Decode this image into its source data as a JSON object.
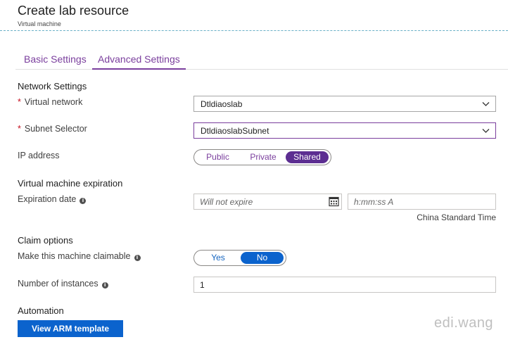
{
  "header": {
    "title": "Create lab resource",
    "subtitle": "Virtual machine"
  },
  "tabs": [
    {
      "label": "Basic Settings",
      "active": false
    },
    {
      "label": "Advanced Settings",
      "active": true
    }
  ],
  "network": {
    "section": "Network Settings",
    "virtual_network": {
      "label": "Virtual network",
      "value": "Dtldiaoslab"
    },
    "subnet": {
      "label": "Subnet Selector",
      "value": "DtldiaoslabSubnet"
    },
    "ip": {
      "label": "IP address",
      "options": [
        "Public",
        "Private",
        "Shared"
      ],
      "selected": "Shared"
    }
  },
  "expiration": {
    "section": "Virtual machine expiration",
    "label": "Expiration date",
    "date_placeholder": "Will not expire",
    "time_placeholder": "h:mm:ss A",
    "timezone": "China Standard Time"
  },
  "claim": {
    "section": "Claim options",
    "label": "Make this machine claimable",
    "options": [
      "Yes",
      "No"
    ],
    "selected": "No"
  },
  "instances": {
    "label": "Number of instances",
    "value": "1"
  },
  "automation": {
    "section": "Automation",
    "button": "View ARM template"
  },
  "watermark": "edi.wang",
  "colors": {
    "accent_purple": "#7a3e9d",
    "selected_purple": "#5c2e91",
    "button_blue": "#0b63cd",
    "required_red": "#c50f1f"
  },
  "icons": [
    "chevron-down-icon",
    "info-icon",
    "calendar-icon"
  ]
}
